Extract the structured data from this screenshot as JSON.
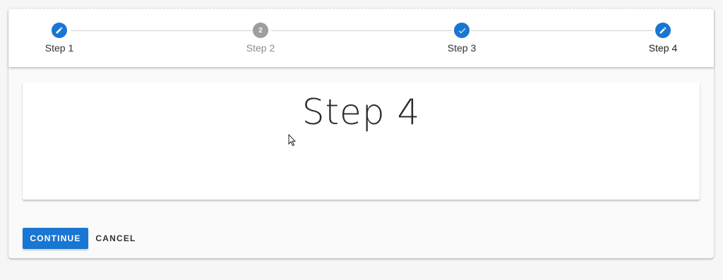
{
  "steps": [
    {
      "label": "Step 1",
      "state": "edit",
      "icon": "pencil-icon"
    },
    {
      "label": "Step 2",
      "state": "inactive",
      "number": "2"
    },
    {
      "label": "Step 3",
      "state": "complete",
      "icon": "check-icon"
    },
    {
      "label": "Step 4",
      "state": "active-edit",
      "icon": "pencil-icon"
    }
  ],
  "content": {
    "title": "Step 4"
  },
  "actions": {
    "continue_label": "CONTINUE",
    "cancel_label": "CANCEL"
  },
  "colors": {
    "primary": "#1976d2",
    "inactive": "#9e9e9e"
  }
}
